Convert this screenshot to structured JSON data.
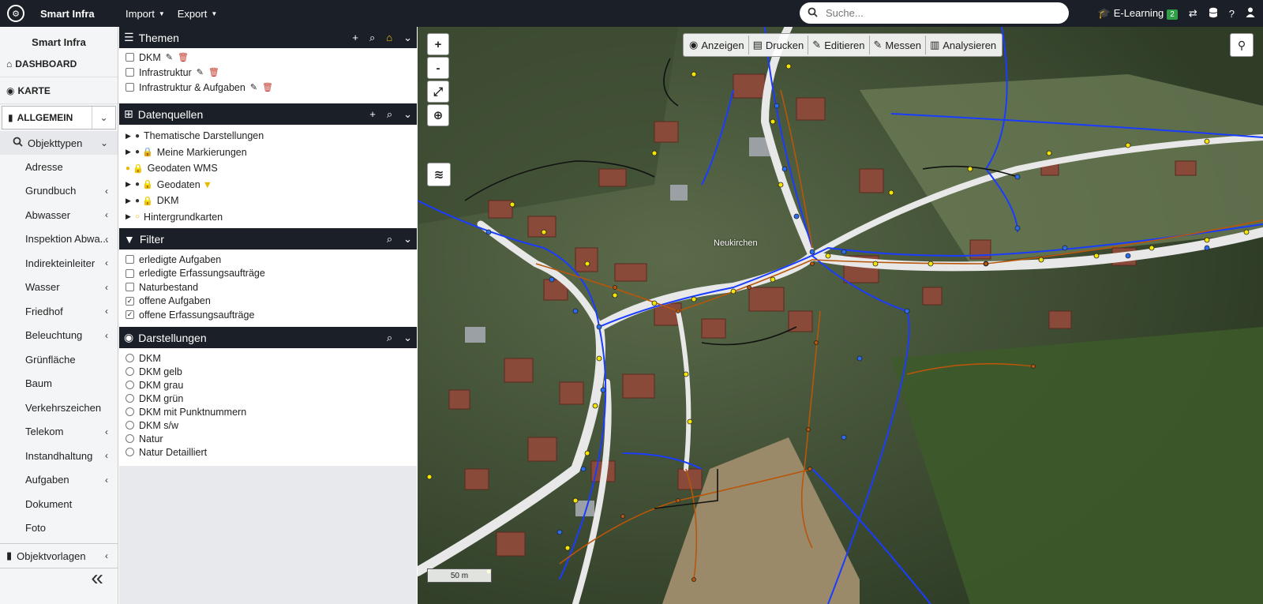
{
  "topbar": {
    "app_name": "Smart Infra",
    "menu": [
      {
        "label": "Import"
      },
      {
        "label": "Export"
      }
    ],
    "search_placeholder": "Suche...",
    "elearning_label": "E-Learning",
    "elearning_badge": "2"
  },
  "sidebar": {
    "title": "Smart Infra",
    "dashboard_label": "DASHBOARD",
    "map_label": "KARTE",
    "select_value": "ALLGEMEIN",
    "objtypes_label": "Objekttypen",
    "items": [
      {
        "label": "Adresse",
        "expandable": false
      },
      {
        "label": "Grundbuch",
        "expandable": true
      },
      {
        "label": "Abwasser",
        "expandable": true
      },
      {
        "label": "Inspektion Abwa...",
        "expandable": true
      },
      {
        "label": "Indirekteinleiter",
        "expandable": true
      },
      {
        "label": "Wasser",
        "expandable": true
      },
      {
        "label": "Friedhof",
        "expandable": true
      },
      {
        "label": "Beleuchtung",
        "expandable": true
      },
      {
        "label": "Grünfläche",
        "expandable": false
      },
      {
        "label": "Baum",
        "expandable": false
      },
      {
        "label": "Verkehrszeichen",
        "expandable": false
      },
      {
        "label": "Telekom",
        "expandable": true
      },
      {
        "label": "Instandhaltung",
        "expandable": true
      },
      {
        "label": "Aufgaben",
        "expandable": true
      },
      {
        "label": "Dokument",
        "expandable": false
      },
      {
        "label": "Foto",
        "expandable": false
      }
    ],
    "vorlagen_label": "Objektvorlagen"
  },
  "themen": {
    "title": "Themen",
    "items": [
      {
        "label": "DKM",
        "checked": false
      },
      {
        "label": "Infrastruktur",
        "checked": false
      },
      {
        "label": "Infrastruktur & Aufgaben",
        "checked": false
      }
    ]
  },
  "datenquellen": {
    "title": "Datenquellen",
    "items": [
      {
        "label": "Thematische Darstellungen",
        "expand": true,
        "bulb": "dark",
        "lock": "none",
        "filter": false
      },
      {
        "label": "Meine Markierungen",
        "expand": true,
        "bulb": "dark",
        "lock": "closed",
        "filter": false
      },
      {
        "label": "Geodaten WMS",
        "expand": false,
        "bulb": "yellow",
        "lock": "open-yellow",
        "filter": false
      },
      {
        "label": "Geodaten",
        "expand": true,
        "bulb": "dark",
        "lock": "open-yellow",
        "filter": true
      },
      {
        "label": "DKM",
        "expand": true,
        "bulb": "dark",
        "lock": "open-outline",
        "filter": false
      },
      {
        "label": "Hintergrundkarten",
        "expand": true,
        "bulb": "outline",
        "lock": "none",
        "filter": false
      }
    ]
  },
  "filter": {
    "title": "Filter",
    "items": [
      {
        "label": "erledigte Aufgaben",
        "checked": false
      },
      {
        "label": "erledigte Erfassungsaufträge",
        "checked": false
      },
      {
        "label": "Naturbestand",
        "checked": false
      },
      {
        "label": "offene Aufgaben",
        "checked": true
      },
      {
        "label": "offene Erfassungsaufträge",
        "checked": true
      }
    ]
  },
  "darstellungen": {
    "title": "Darstellungen",
    "items": [
      {
        "label": "DKM"
      },
      {
        "label": "DKM gelb"
      },
      {
        "label": "DKM grau"
      },
      {
        "label": "DKM grün"
      },
      {
        "label": "DKM mit Punktnummern"
      },
      {
        "label": "DKM s/w"
      },
      {
        "label": "Natur"
      },
      {
        "label": "Natur Detailliert"
      }
    ]
  },
  "map": {
    "zoom_in": "+",
    "zoom_out": "-",
    "toolbar": [
      {
        "label": "Anzeigen",
        "icon": "eye-icon"
      },
      {
        "label": "Drucken",
        "icon": "print-icon"
      },
      {
        "label": "Editieren",
        "icon": "pencil-icon"
      },
      {
        "label": "Messen",
        "icon": "pencil-icon"
      },
      {
        "label": "Analysieren",
        "icon": "chart-icon"
      }
    ],
    "scale_label": "50 m",
    "place_label": "Neukirchen",
    "colors": {
      "water": "#1a3cff",
      "sewer": "#b8560a",
      "lighting": "#f5e400",
      "road": "#e8e8e8"
    }
  }
}
